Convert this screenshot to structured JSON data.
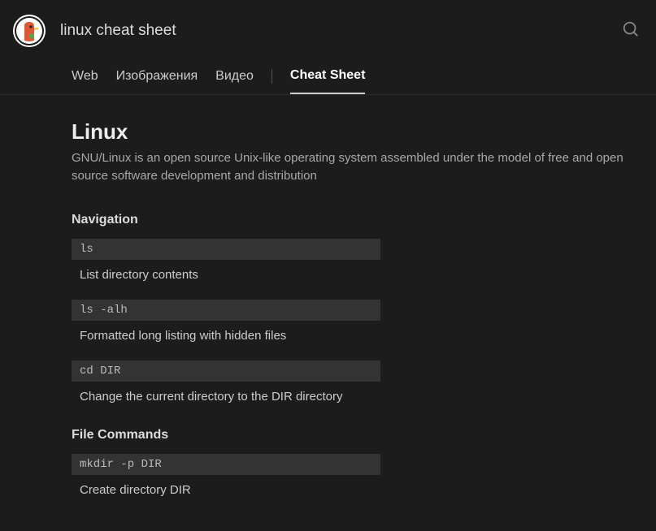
{
  "search": {
    "query": "linux cheat sheet"
  },
  "tabs": {
    "web": "Web",
    "images": "Изображения",
    "video": "Видео",
    "cheatsheet": "Cheat Sheet"
  },
  "main": {
    "title": "Linux",
    "subtitle": "GNU/Linux is an open source Unix-like operating system assembled under the model of free and open source software development and distribution"
  },
  "sections": {
    "navigation": {
      "heading": "Navigation",
      "items": [
        {
          "code": "ls",
          "desc": "List directory contents"
        },
        {
          "code": "ls -alh",
          "desc": "Formatted long listing with hidden files"
        },
        {
          "code": "cd DIR",
          "desc": "Change the current directory to the DIR directory"
        }
      ]
    },
    "file_commands": {
      "heading": "File Commands",
      "items": [
        {
          "code": "mkdir -p DIR",
          "desc": "Create directory DIR"
        }
      ]
    }
  }
}
